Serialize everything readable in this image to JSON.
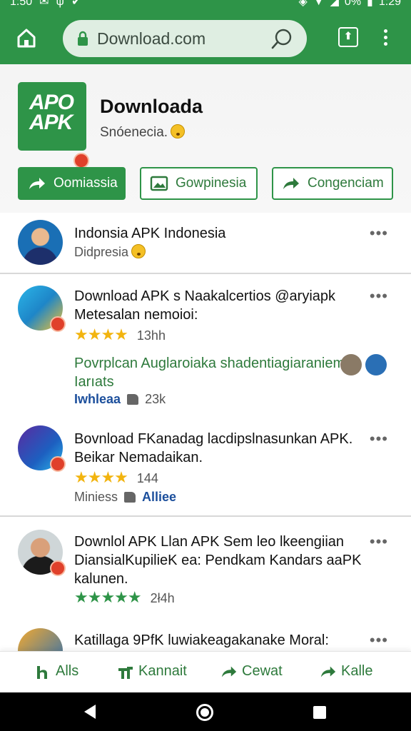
{
  "status_bar": {
    "time": "1:50",
    "battery": "0%",
    "clock": "1:29"
  },
  "browser": {
    "url": "Download.com"
  },
  "app": {
    "title": "Downloada",
    "subtitle": "Snóenecia.",
    "logo_line1": "APO",
    "logo_line2": "APK",
    "buttons": [
      {
        "label": "Oomiassia"
      },
      {
        "label": "Gowpinesia"
      },
      {
        "label": "Congenciam"
      }
    ]
  },
  "feed": [
    {
      "title": "Indonsia APK Indonesia",
      "meta": "Didpresia",
      "more": "•••"
    },
    {
      "title_line1": "Download APK s Naakalcertios @aryiapk",
      "title_line2": "Metesalan nemoioi:",
      "stars": "★★★★",
      "rating": "13hh",
      "promo_line1": "Povrplcan Auglaroiaka shadentiagiaraniem",
      "promo_line2": "Iarıats",
      "footer_link": "Iwhleaa",
      "footer_count": "23k",
      "more": "•••"
    },
    {
      "title_line1": "Bovnload FKanadag lacdipslnasunkan APK.",
      "title_line2": "Beikar Nemadaikan.",
      "stars": "★★★★",
      "rating": "144",
      "footer_text": "Miniess",
      "footer_link": "Alliee",
      "more": "•••"
    },
    {
      "title_line1": "Downlol APK Llan APK Sem leo lkeengiian",
      "title_line2": "DiansialKupilieK ea: Pendkam Kandars aaPK",
      "title_line3": "kalunen.",
      "stars": "★★★★★",
      "rating": "2ł4h",
      "more": "•••"
    },
    {
      "title_line1": "Katillaga 9PfK luwiakeagakanake Moral:",
      "more": "•••"
    }
  ],
  "bottom_nav": [
    {
      "label": "Alls"
    },
    {
      "label": "Kannait"
    },
    {
      "label": "Cewat"
    },
    {
      "label": "Kalle"
    }
  ],
  "colors": {
    "brand_green": "#2e9448",
    "star_yellow": "#f2b40f",
    "badge_red": "#e0402a"
  }
}
